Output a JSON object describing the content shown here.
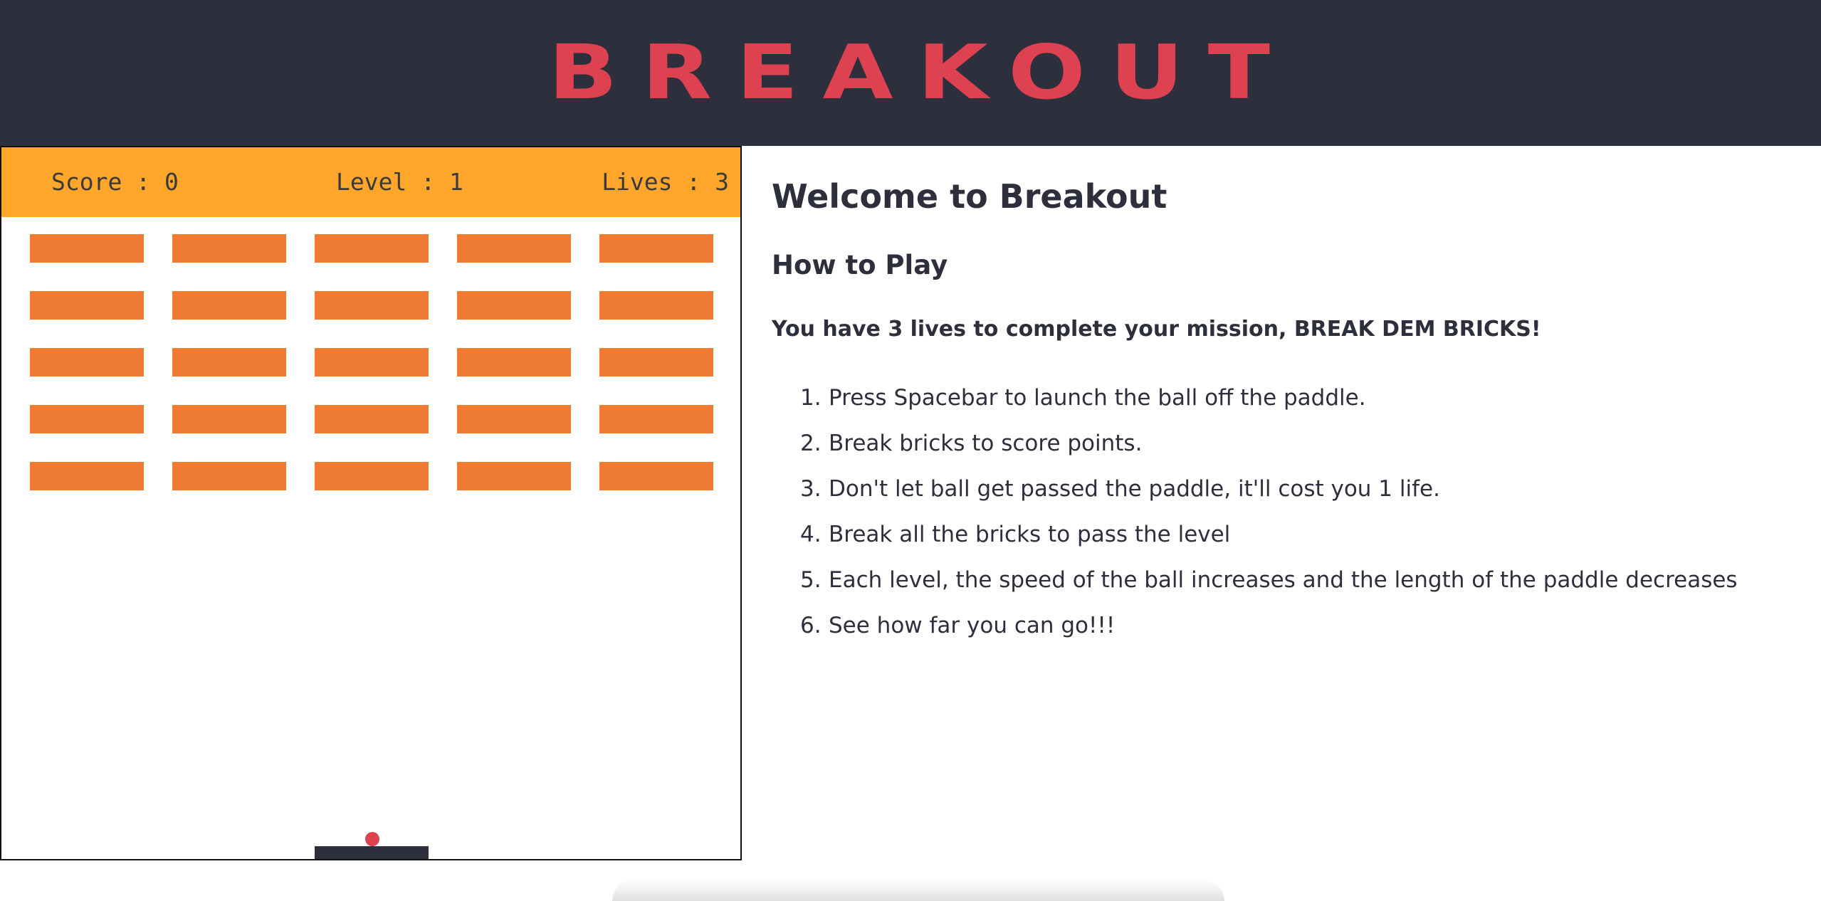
{
  "header": {
    "title": "BREAKOUT"
  },
  "hud": {
    "score": "Score : 0",
    "level": "Level : 1",
    "lives": "Lives : 3"
  },
  "game": {
    "brick_rows": 5,
    "brick_cols": 5,
    "ball_color": "#de4150",
    "paddle_color": "#2d2f3c",
    "brick_color": "#ef7b33",
    "hud_color": "#ffa62b"
  },
  "rules": {
    "heading": "Welcome to Breakout",
    "subheading": "How to Play",
    "mission": "You have 3 lives to complete your mission, BREAK DEM BRICKS!",
    "items": [
      "Press Spacebar to launch the ball off the paddle.",
      "Break bricks to score points.",
      "Don't let ball get passed the paddle, it'll cost you 1 life.",
      "Break all the bricks to pass the level",
      "Each level, the speed of the ball increases and the length of the paddle decreases",
      "See how far you can go!!!"
    ],
    "numbers": [
      "1.",
      "2.",
      "3.",
      "4.",
      "5.",
      "6."
    ]
  },
  "colors": {
    "header_bg": "#2d2f3c",
    "title": "#de4150",
    "text": "#2d2f3c"
  }
}
